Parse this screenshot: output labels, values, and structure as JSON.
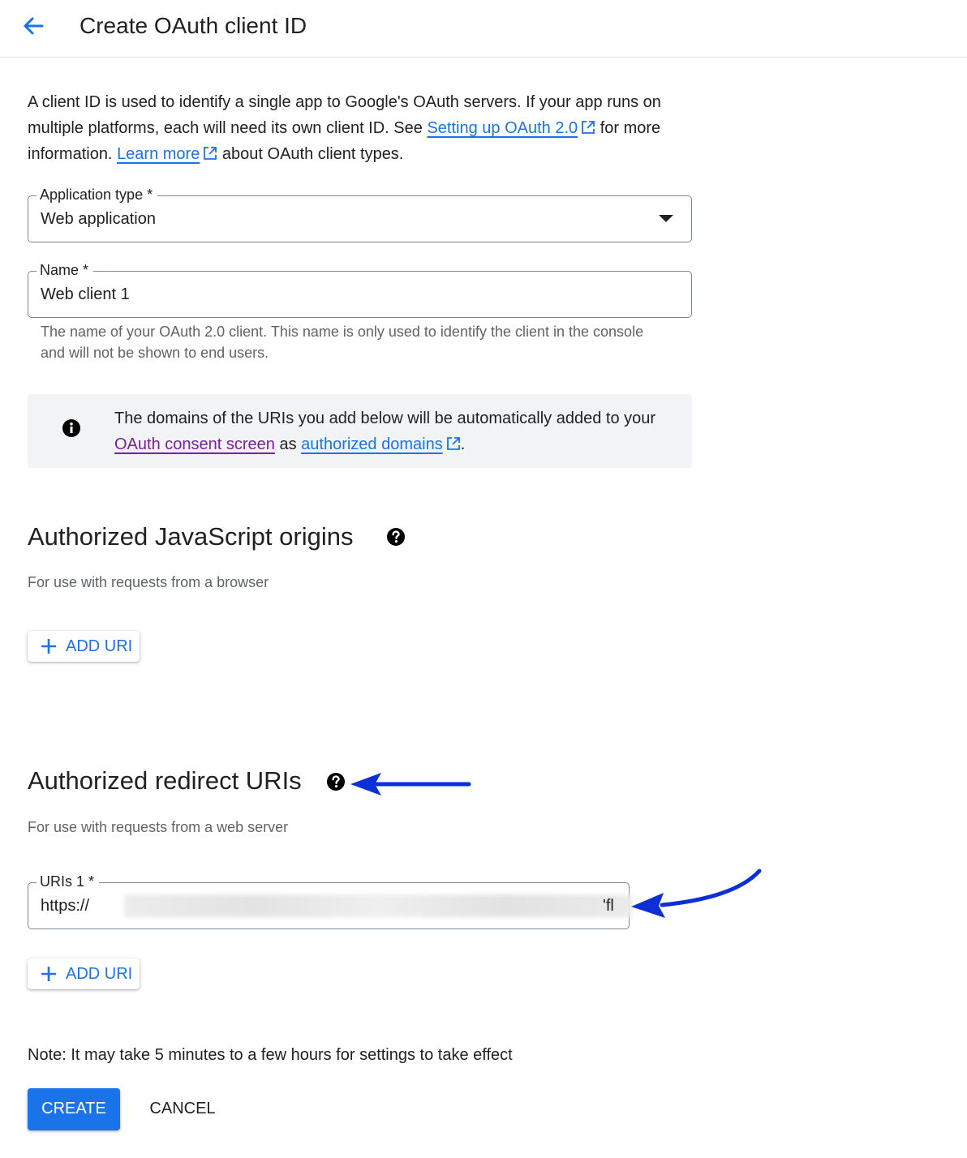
{
  "header": {
    "title": "Create OAuth client ID",
    "back_icon": "arrow-back-icon"
  },
  "intro": {
    "text_1": "A client ID is used to identify a single app to Google's OAuth servers. If your app runs on multiple platforms, each will need its own client ID. See ",
    "link_setup": "Setting up OAuth 2.0",
    "text_2": " for more information. ",
    "link_learn": "Learn more",
    "text_3": " about OAuth client types."
  },
  "app_type": {
    "label": "Application type *",
    "value": "Web application"
  },
  "name_field": {
    "label": "Name *",
    "value": "Web client 1",
    "helper": "The name of your OAuth 2.0 client. This name is only used to identify the client in the console and will not be shown to end users."
  },
  "info_box": {
    "text_1": "The domains of the URIs you add below will be automatically added to your ",
    "link_consent": "OAuth consent screen",
    "text_2": " as ",
    "link_domains": "authorized domains",
    "text_3": "."
  },
  "js_origins": {
    "title": "Authorized JavaScript origins",
    "subtitle": "For use with requests from a browser",
    "add_label": "ADD URI"
  },
  "redirect_uris": {
    "title": "Authorized redirect URIs",
    "subtitle": "For use with requests from a web server",
    "field_label": "URIs 1 *",
    "value_prefix": "https://",
    "value_suffix": "'fl",
    "add_label": "ADD URI"
  },
  "note": "Note: It may take 5 minutes to a few hours for settings to take effect",
  "actions": {
    "create": "CREATE",
    "cancel": "CANCEL"
  },
  "colors": {
    "primary": "#1a73e8",
    "visited_link": "#7b1fa2",
    "annotation_arrow": "#0d2fd6"
  }
}
